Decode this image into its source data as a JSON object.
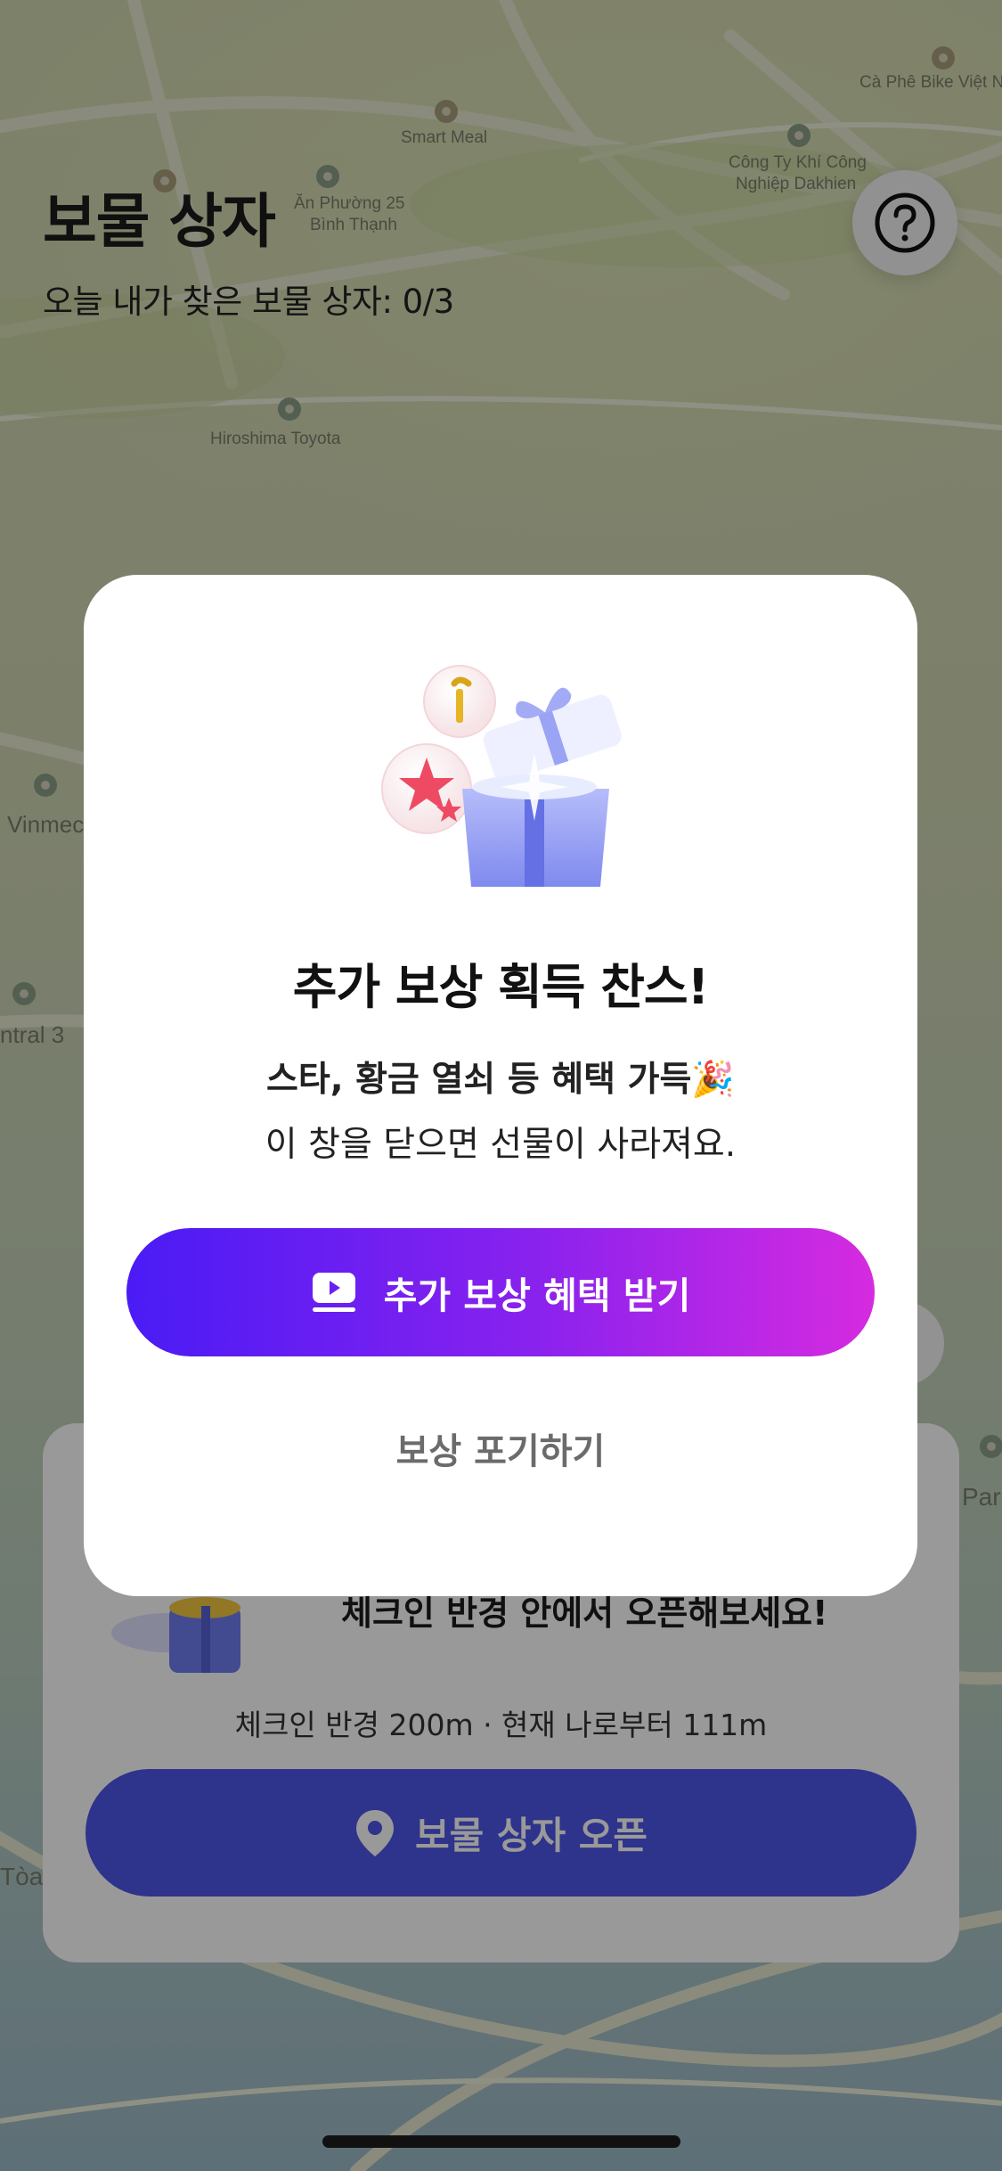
{
  "map": {
    "labels": [
      "Cà Phê Bike Việt N",
      "Smart Meal",
      "Công Ty Khí Công",
      "Nghiệp Dakhien",
      "Ăn Phường 25",
      "Bình Thạnh",
      "Hiroshima Toyota",
      "Vinmec",
      "ntral 3",
      "Par",
      "Tòa"
    ]
  },
  "header": {
    "title": "보물 상자",
    "subtitle": "오늘 내가 찾은 보물 상자: 0/3"
  },
  "bottom_card": {
    "headline": "체크인 반경 안에서 오픈해보세요!",
    "info": "체크인 반경 200m · 현재 나로부터 111m",
    "open_button": "보물 상자 오픈"
  },
  "modal": {
    "title": "추가 보상 획득 찬스!",
    "line1": "스타, 황금 열쇠 등 혜택 가득🎉",
    "line2": "이 창을 닫으면 선물이 사라져요.",
    "reward_button": "추가 보상 혜택 받기",
    "giveup_button": "보상 포기하기"
  },
  "colors": {
    "primary": "#4e55e8",
    "gradient_start": "#4a1bf5",
    "gradient_end": "#d62be0"
  }
}
